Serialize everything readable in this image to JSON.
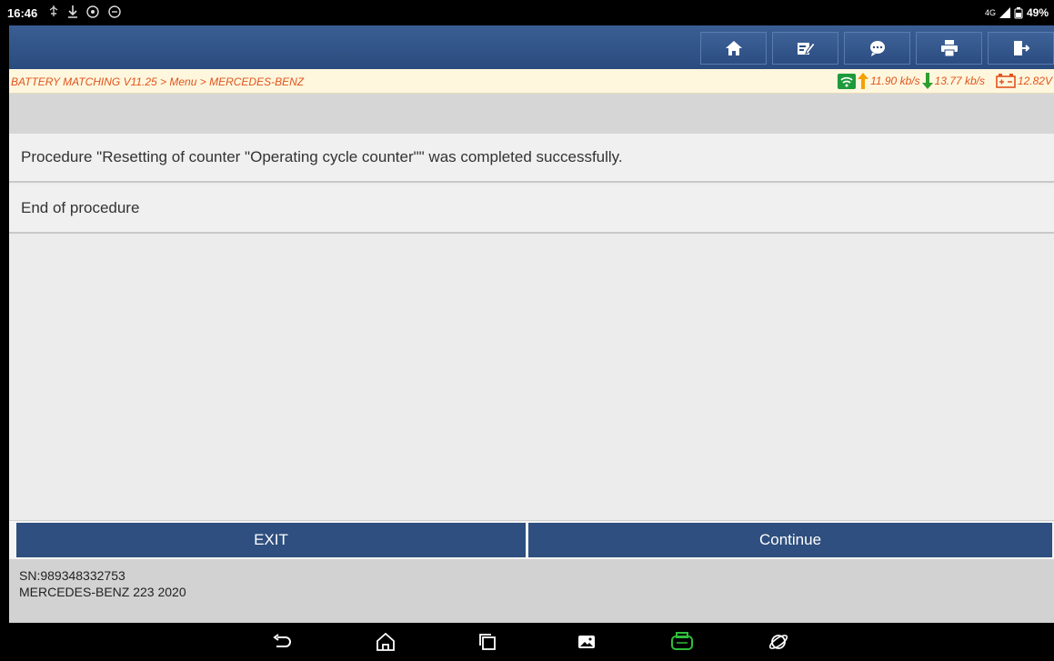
{
  "status_bar": {
    "time": "16:46",
    "network": "4G",
    "battery": "49%"
  },
  "toolbar": {
    "icons": [
      "home-icon",
      "edit-icon",
      "chat-icon",
      "print-icon",
      "exit-icon"
    ]
  },
  "breadcrumb": "BATTERY MATCHING V11.25 > Menu > MERCEDES-BENZ",
  "network_status": {
    "upload": "11.90 kb/s",
    "download": "13.77 kb/s",
    "voltage": "12.82V"
  },
  "messages": [
    "Procedure \"Resetting of counter \"Operating cycle counter\"\" was completed successfully.",
    "End of procedure"
  ],
  "buttons": {
    "exit": "EXIT",
    "continue": "Continue"
  },
  "footer": {
    "sn": "SN:989348332753",
    "vehicle": "MERCEDES-BENZ 223 2020"
  },
  "colors": {
    "toolbar": "#2e4f7f",
    "breadcrumb_text": "#e0531e",
    "upload_arrow": "#f5a000",
    "download_arrow": "#2e9e2e"
  }
}
